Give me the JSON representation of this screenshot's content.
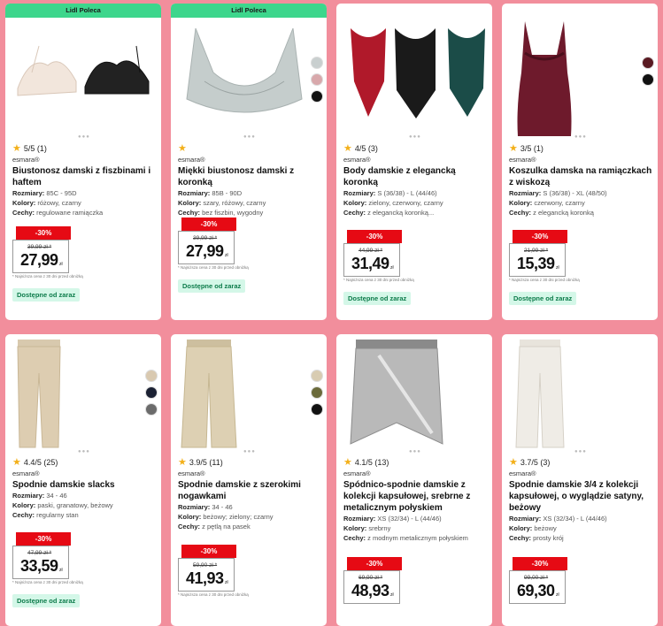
{
  "products": [
    {
      "badge": "Lidl Poleca",
      "rating": "5/5 (1)",
      "brand": "esmara®",
      "title": "Biustonosz damski z fiszbinami i haftem",
      "attrs": [
        {
          "k": "Rozmiary:",
          "v": "85C - 95D"
        },
        {
          "k": "Kolory:",
          "v": "różowy, czarny"
        },
        {
          "k": "Cechy:",
          "v": "regulowane ramiączka"
        }
      ],
      "discount": "-30%",
      "old_price": "39,99 zł *",
      "price": "27,99",
      "currency": "zł",
      "note": "* Najniższa cena z 30 dni przed obniżką",
      "availability": "Dostępne od zaraz",
      "swatches": []
    },
    {
      "badge": "Lidl Poleca",
      "rating": "",
      "brand": "esmara®",
      "title": "Miękki biustonosz damski z koronką",
      "attrs": [
        {
          "k": "Rozmiary:",
          "v": "85B - 90D"
        },
        {
          "k": "Kolory:",
          "v": "szary, różowy, czarny"
        },
        {
          "k": "Cechy:",
          "v": "bez fiszbin, wygodny"
        }
      ],
      "discount": "-30%",
      "old_price": "39,99 zł *",
      "price": "27,99",
      "currency": "zł",
      "note": "* Najniższa cena z 30 dni przed obniżką",
      "availability": "Dostępne od zaraz",
      "swatches": [
        "#c9cfcf",
        "#d8a8ab",
        "#111111"
      ]
    },
    {
      "badge": "",
      "rating": "4/5 (3)",
      "brand": "esmara®",
      "title": "Body damskie z elegancką koronką",
      "attrs": [
        {
          "k": "Rozmiary:",
          "v": "S (36/38) - L (44/46)"
        },
        {
          "k": "Kolory:",
          "v": "zielony, czerwony, czarny"
        },
        {
          "k": "Cechy:",
          "v": "z elegancką koronką..."
        }
      ],
      "discount": "-30%",
      "old_price": "44,99 zł *",
      "price": "31,49",
      "currency": "zł",
      "note": "* Najniższa cena z 30 dni przed obniżką",
      "availability": "Dostępne od zaraz",
      "swatches": []
    },
    {
      "badge": "",
      "rating": "3/5 (1)",
      "brand": "esmara®",
      "title": "Koszulka damska na ramiączkach z wiskozą",
      "attrs": [
        {
          "k": "Rozmiary:",
          "v": "S (36/38) - XL (48/50)"
        },
        {
          "k": "Kolory:",
          "v": "czerwony, czarny"
        },
        {
          "k": "Cechy:",
          "v": "z elegancką koronką"
        }
      ],
      "discount": "-30%",
      "old_price": "21,99 zł *",
      "price": "15,39",
      "currency": "zł",
      "note": "* Najniższa cena z 30 dni przed obniżką",
      "availability": "Dostępne od zaraz",
      "swatches": [
        "#5a1a22",
        "#111111"
      ]
    },
    {
      "badge": "",
      "rating": "4.4/5 (25)",
      "brand": "esmara®",
      "title": "Spodnie damskie slacks",
      "attrs": [
        {
          "k": "Rozmiary:",
          "v": "34 - 46"
        },
        {
          "k": "Kolory:",
          "v": "paski, granatowy, beżowy"
        },
        {
          "k": "Cechy:",
          "v": "regularny stan"
        }
      ],
      "discount": "-30%",
      "old_price": "47,99 zł *",
      "price": "33,59",
      "currency": "zł",
      "note": "* Najniższa cena z 30 dni przed obniżką",
      "availability": "Dostępne od zaraz",
      "swatches": [
        "#d9c9b0",
        "#1b2133",
        "#6b6b6b"
      ]
    },
    {
      "badge": "",
      "rating": "3.9/5 (11)",
      "brand": "esmara®",
      "title": "Spodnie damskie z szerokimi nogawkami",
      "attrs": [
        {
          "k": "Rozmiary:",
          "v": "34 - 46"
        },
        {
          "k": "Kolory:",
          "v": "beżowy; zielony; czarny"
        },
        {
          "k": "Cechy:",
          "v": "z pętlą na pasek"
        }
      ],
      "discount": "-30%",
      "old_price": "59,90 zł *",
      "price": "41,93",
      "currency": "zł",
      "note": "* Najniższa cena z 30 dni przed obniżką",
      "availability": "",
      "swatches": [
        "#d8ccb2",
        "#6a6a3a",
        "#111111"
      ]
    },
    {
      "badge": "",
      "rating": "4.1/5 (13)",
      "brand": "esmara®",
      "title": "Spódnico-spodnie damskie z kolekcji kapsułowej, srebrne z metalicznym połyskiem",
      "attrs": [
        {
          "k": "Rozmiary:",
          "v": "XS (32/34) - L (44/46)"
        },
        {
          "k": "Kolory:",
          "v": "srebrny"
        },
        {
          "k": "Cechy:",
          "v": "z modnym metalicznym połyskiem"
        }
      ],
      "discount": "-30%",
      "old_price": "69,90 zł *",
      "price": "48,93",
      "currency": "zł",
      "note": "",
      "availability": "",
      "swatches": []
    },
    {
      "badge": "",
      "rating": "3.7/5 (3)",
      "brand": "esmara®",
      "title": "Spodnie damskie 3/4 z kolekcji kapsułowej, o wyglądzie satyny, beżowy",
      "attrs": [
        {
          "k": "Rozmiary:",
          "v": "XS (32/34) - L (44/46)"
        },
        {
          "k": "Kolory:",
          "v": "beżowy"
        },
        {
          "k": "Cechy:",
          "v": "prosty krój"
        }
      ],
      "discount": "-30%",
      "old_price": "99,00 zł *",
      "price": "69,30",
      "currency": "zł",
      "note": "",
      "availability": "",
      "swatches": []
    }
  ]
}
